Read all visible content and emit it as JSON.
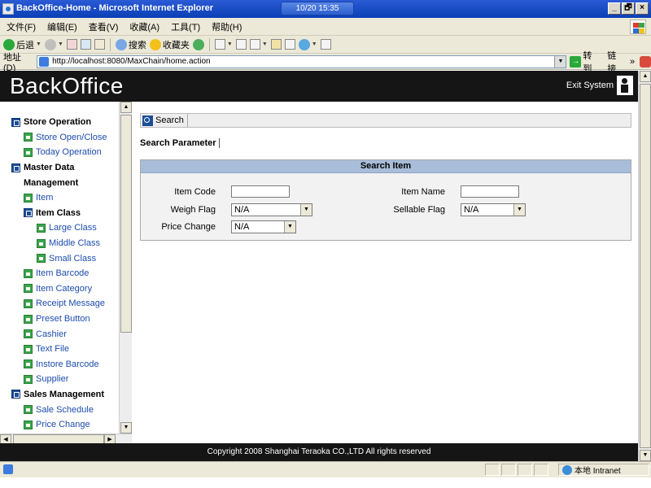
{
  "window": {
    "title": "BackOffice-Home - Microsoft Internet Explorer",
    "clock": "10/20  15:35",
    "controls": [
      "_",
      "🗗",
      "×"
    ]
  },
  "menu": [
    "文件(F)",
    "编辑(E)",
    "查看(V)",
    "收藏(A)",
    "工具(T)",
    "帮助(H)"
  ],
  "toolbar": {
    "back_label": "后退",
    "search_label": "搜索",
    "favorites_label": "收藏夹"
  },
  "address": {
    "label": "地址(D)",
    "url": "http://localhost:8080/MaxChain/home.action",
    "go_label": "转到",
    "links_label": "链接",
    "more": "»"
  },
  "header": {
    "brand": "BackOffice",
    "exit_label": "Exit System"
  },
  "sidebar": {
    "items": [
      {
        "label": "Store Operation",
        "level": 0,
        "icon": "folder-icon"
      },
      {
        "label": "Store Open/Close",
        "level": 1,
        "icon": "document-icon"
      },
      {
        "label": "Today Operation",
        "level": 1,
        "icon": "document-icon"
      },
      {
        "label": "Master Data",
        "level": 0,
        "icon": "folder-icon"
      },
      {
        "label": "Management",
        "level": 0,
        "icon": "none"
      },
      {
        "label": "Item",
        "level": 1,
        "icon": "document-icon"
      },
      {
        "label": "Item Class",
        "level": 1,
        "icon": "folder-icon"
      },
      {
        "label": "Large Class",
        "level": 2,
        "icon": "document-icon"
      },
      {
        "label": "Middle Class",
        "level": 2,
        "icon": "document-icon"
      },
      {
        "label": "Small Class",
        "level": 2,
        "icon": "document-icon"
      },
      {
        "label": "Item Barcode",
        "level": 1,
        "icon": "document-icon"
      },
      {
        "label": "Item Category",
        "level": 1,
        "icon": "document-icon"
      },
      {
        "label": "Receipt Message",
        "level": 1,
        "icon": "document-icon"
      },
      {
        "label": "Preset Button",
        "level": 1,
        "icon": "document-icon"
      },
      {
        "label": "Cashier",
        "level": 1,
        "icon": "document-icon"
      },
      {
        "label": "Text File",
        "level": 1,
        "icon": "document-icon"
      },
      {
        "label": "Instore Barcode",
        "level": 1,
        "icon": "document-icon"
      },
      {
        "label": "Supplier",
        "level": 1,
        "icon": "document-icon"
      },
      {
        "label": "Sales Management",
        "level": 0,
        "icon": "folder-icon"
      },
      {
        "label": "Sale Schedule",
        "level": 1,
        "icon": "document-icon"
      },
      {
        "label": "Price Change",
        "level": 1,
        "icon": "document-icon"
      }
    ]
  },
  "main": {
    "search_button": "Search",
    "param_title": "Search Parameter",
    "panel_title": "Search Item",
    "fields": {
      "item_code": {
        "label": "Item Code",
        "value": ""
      },
      "item_name": {
        "label": "Item Name",
        "value": ""
      },
      "weigh_flag": {
        "label": "Weigh Flag",
        "value": "N/A"
      },
      "sellable_flag": {
        "label": "Sellable Flag",
        "value": "N/A"
      },
      "price_change": {
        "label": "Price Change",
        "value": "N/A"
      }
    }
  },
  "footer": "Copyright 2008 Shanghai Teraoka CO.,LTD All rights reserved",
  "status": {
    "zone": "本地 Intranet"
  },
  "colors": {
    "header_bg": "#151515",
    "panel_header": "#a8bdd9",
    "link": "#1d4cae",
    "doc_icon": "#3aa64a",
    "folder_icon": "#1c4e96"
  }
}
